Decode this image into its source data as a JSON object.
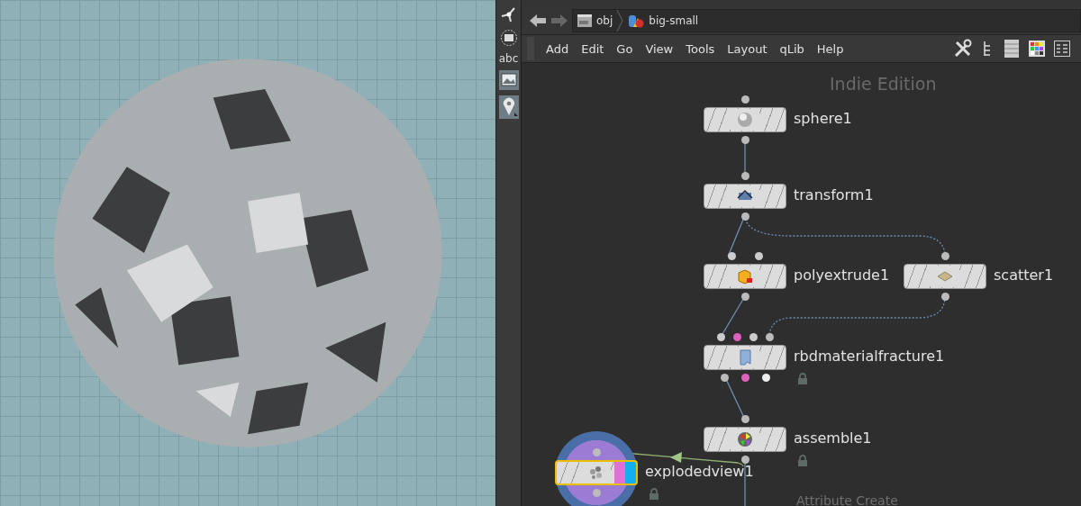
{
  "viewport": {
    "toolbar": {
      "label": "abc"
    }
  },
  "path_bar": {
    "items": [
      {
        "label": "obj",
        "kind": "context"
      },
      {
        "label": "big-small",
        "kind": "geo"
      }
    ]
  },
  "menu": [
    "Add",
    "Edit",
    "Go",
    "View",
    "Tools",
    "Layout",
    "qLib",
    "Help"
  ],
  "edition_label": "Indie Edition",
  "nodes": [
    {
      "name": "sphere1",
      "kind": "sphere",
      "selected": false,
      "locked": false
    },
    {
      "name": "transform1",
      "kind": "transform",
      "selected": false,
      "locked": false
    },
    {
      "name": "polyextrude1",
      "kind": "polyextrude",
      "selected": false,
      "locked": false
    },
    {
      "name": "scatter1",
      "kind": "scatter",
      "selected": false,
      "locked": false
    },
    {
      "name": "rbdmaterialfracture1",
      "kind": "fracture",
      "selected": false,
      "locked": true
    },
    {
      "name": "assemble1",
      "kind": "assemble",
      "selected": false,
      "locked": true
    },
    {
      "name": "explodedview1",
      "kind": "explodedview",
      "selected": true,
      "locked": true
    }
  ],
  "hint_text": "Attribute Create"
}
